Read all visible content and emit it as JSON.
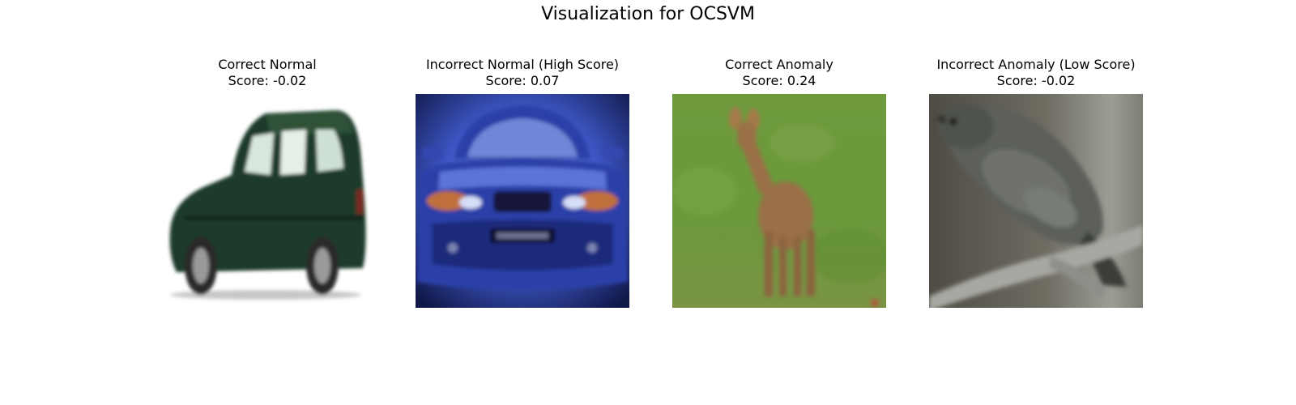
{
  "figure": {
    "title": "Visualization for OCSVM"
  },
  "panels": [
    {
      "label": "Correct Normal",
      "score": "Score: -0.02",
      "image_subject": "car-photo",
      "colors": {
        "background": "#ffffff",
        "body": "#1f3b2a",
        "window": "#d9e6dc"
      }
    },
    {
      "label": "Incorrect Normal (High Score)",
      "score": "Score: 0.07",
      "image_subject": "car-photo",
      "colors": {
        "background": "#2a3c9e",
        "body": "#2b3fa8",
        "glow": "#8aa2f0"
      }
    },
    {
      "label": "Correct Anomaly",
      "score": "Score: 0.24",
      "image_subject": "deer-photo",
      "colors": {
        "background": "#6e9a3c",
        "animal": "#9a7046"
      }
    },
    {
      "label": "Incorrect Anomaly (Low Score)",
      "score": "Score: -0.02",
      "image_subject": "bird-photo",
      "colors": {
        "background": "#6f6c62",
        "bird": "#5c5f5a",
        "branch": "#a7a8a3"
      }
    }
  ]
}
